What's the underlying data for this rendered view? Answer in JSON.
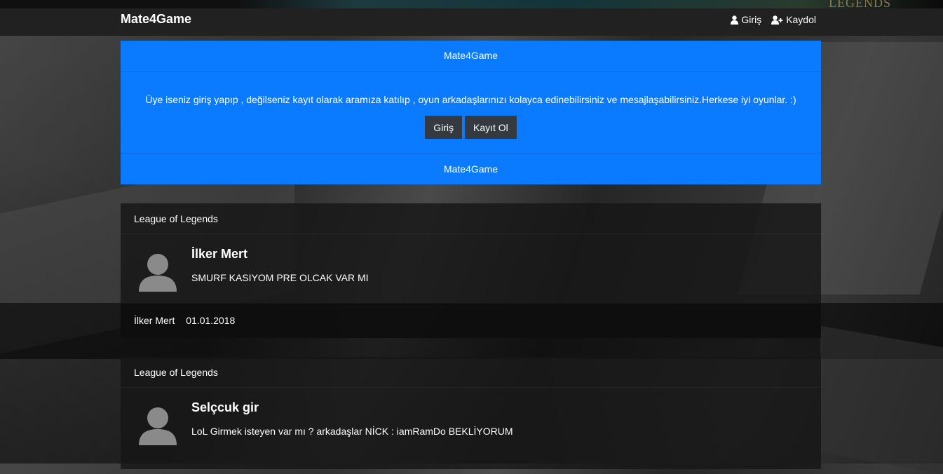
{
  "header_banner": {
    "corner_text": "LEGENDS"
  },
  "navbar": {
    "brand": "Mate4Game",
    "links": [
      {
        "label": "Giriş",
        "icon": "user-icon"
      },
      {
        "label": "Kaydol",
        "icon": "user-plus-icon"
      }
    ]
  },
  "jumbotron": {
    "header": "Mate4Game",
    "message": "Üye iseniz giriş yapıp , değilseniz kayıt olarak aramıza katılıp , oyun arkadaşlarınızı kolayca edinebilirsiniz ve mesajlaşabilirsiniz.Herkese iyi oyunlar. :)",
    "buttons": {
      "login": "Giriş",
      "register": "Kayıt Ol"
    },
    "footer": "Mate4Game"
  },
  "posts": [
    {
      "game": "League of Legends",
      "author": "İlker Mert",
      "text": "SMURF KASIYOM PRE OLCAK VAR MI",
      "footer_author": "İlker Mert",
      "date": "01.01.2018"
    },
    {
      "game": "League of Legends",
      "author": "Selçcuk gir",
      "text": "LoL Girmek isteyen var mı ? arkadaşlar NİCK : iamRamDo BEKLİYORUM"
    }
  ],
  "colors": {
    "accent": "#0a7bff",
    "navbar": "#212121",
    "button": "#343a40"
  }
}
